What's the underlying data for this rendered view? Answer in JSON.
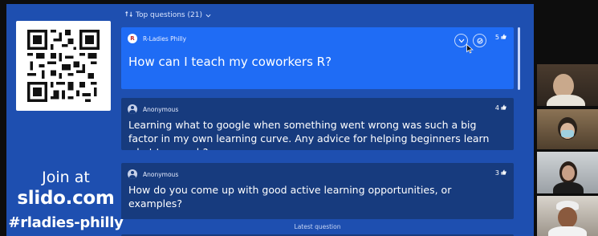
{
  "sidebar": {
    "join_at": "Join at",
    "domain": "slido.com",
    "event_code": "#rladies-philly"
  },
  "header": {
    "title": "Top questions (21)",
    "dropdown_icon": "chevron-down-icon",
    "sort_icon": "sort-icon"
  },
  "questions": [
    {
      "author": "R-Ladies Philly",
      "avatar_letter": "R",
      "text": "How can I teach my coworkers R?",
      "likes": "5",
      "highlighted": true
    },
    {
      "author": "Anonymous",
      "text": "Learning what to google when something went wrong was such a big factor in my own learning curve. Any advice for helping beginners learn what to search?",
      "likes": "4",
      "highlighted": false
    },
    {
      "author": "Anonymous",
      "text": "How do you come up with good active learning opportunities, or examples?",
      "likes": "3",
      "highlighted": false
    }
  ],
  "latest_label": "Latest question",
  "colors": {
    "panel": "#1e4fb0",
    "highlight_card": "#1f6cf5",
    "card": "#173b7e"
  }
}
